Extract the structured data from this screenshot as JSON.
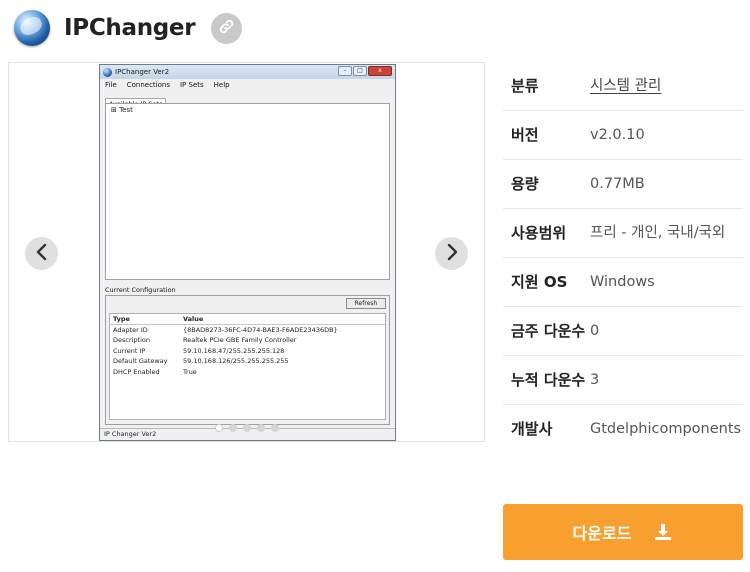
{
  "header": {
    "app_name": "IPChanger",
    "logo_icon": "globe-logo-icon",
    "share_icon": "link-icon"
  },
  "carousel": {
    "prev_icon": "chevron-left-icon",
    "next_icon": "chevron-right-icon",
    "dots_total": 5,
    "active_dot": 1,
    "screenshot": {
      "window_title": "IPChanger Ver2",
      "menu": [
        "File",
        "Connections",
        "IP Sets",
        "Help"
      ],
      "tab": "Available IP Sets",
      "tree_item": "Test",
      "config_label": "Current Configuration",
      "refresh_label": "Refresh",
      "grid_headers": [
        "Type",
        "Value"
      ],
      "grid_rows": [
        {
          "type": "Adapter ID",
          "value": "{8BAD8273-36FC-4D74-BAE3-F6ADE23436DB}"
        },
        {
          "type": "Description",
          "value": "Realtek PCIe GBE Family Controller"
        },
        {
          "type": "Current IP",
          "value": "59.10.168.47/255.255.255.128"
        },
        {
          "type": "Default Gateway",
          "value": "59.10.168.126/255.255.255.255"
        },
        {
          "type": "DHCP Enabled",
          "value": "True"
        }
      ],
      "status": "IP Changer Ver2"
    }
  },
  "info": {
    "rows": [
      {
        "key": "분류",
        "value": "시스템 관리"
      },
      {
        "key": "버전",
        "value": "v2.0.10"
      },
      {
        "key": "용량",
        "value": "0.77MB"
      },
      {
        "key": "사용범위",
        "value": "프리 - 개인, 국내/국외"
      },
      {
        "key": "지원 OS",
        "value": "Windows"
      },
      {
        "key": "금주 다운수",
        "value": "0"
      },
      {
        "key": "누적 다운수",
        "value": "3"
      },
      {
        "key": "개발사",
        "value": "Gtdelphicomponents"
      }
    ]
  },
  "download": {
    "label": "다운로드",
    "icon": "download-icon"
  },
  "colors": {
    "accent": "#f7a030",
    "arrow_bg": "#e0e0e0",
    "link_btn_bg": "#c9c9c9"
  }
}
